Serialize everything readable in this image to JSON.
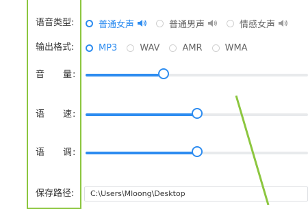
{
  "voice_type": {
    "label_c1": "语音类型",
    "colon": ":",
    "options": [
      {
        "label": "普通女声",
        "selected": true
      },
      {
        "label": "普通男声",
        "selected": false
      },
      {
        "label": "情感女声",
        "selected": false
      }
    ]
  },
  "output_format": {
    "label_c1": "输出格式",
    "colon": ":",
    "options": [
      {
        "label": "MP3",
        "selected": true
      },
      {
        "label": "WAV",
        "selected": false
      },
      {
        "label": "AMR",
        "selected": false
      },
      {
        "label": "WMA",
        "selected": false
      }
    ]
  },
  "volume": {
    "label_a": "音",
    "label_b": "量",
    "colon": ":",
    "value_fraction": 0.35
  },
  "speed": {
    "label_a": "语",
    "label_b": "速",
    "colon": ":",
    "value_fraction": 0.5
  },
  "pitch": {
    "label_a": "语",
    "label_b": "调",
    "colon": ":",
    "value_fraction": 0.5
  },
  "save_path": {
    "label": "保存路径",
    "colon": ":",
    "value": "C:\\Users\\Mloong\\Desktop"
  },
  "colors": {
    "accent": "#2d8cf0",
    "highlight": "#8cc63f",
    "track": "#e8eaec"
  }
}
